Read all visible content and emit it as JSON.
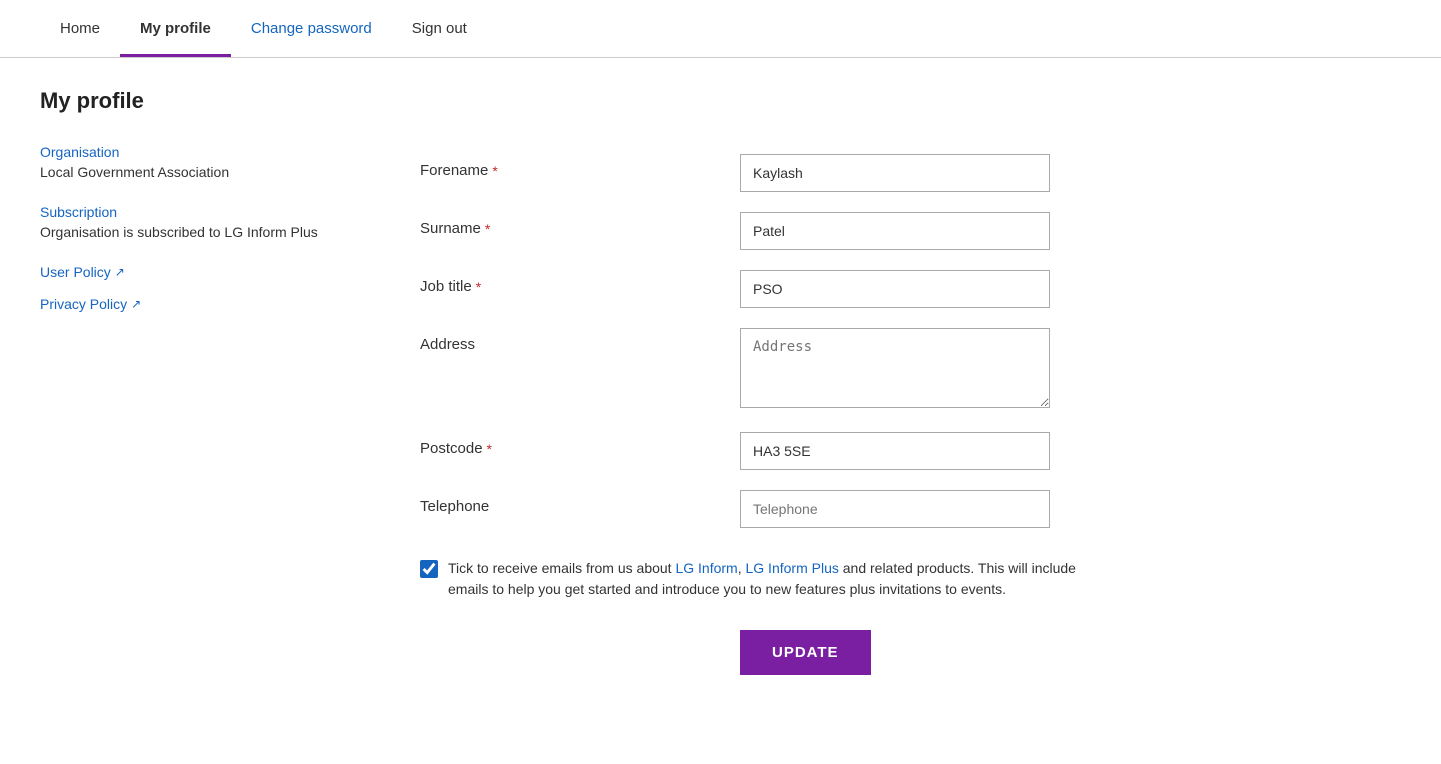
{
  "nav": {
    "items": [
      {
        "id": "home",
        "label": "Home",
        "active": false,
        "link": true
      },
      {
        "id": "my-profile",
        "label": "My profile",
        "active": true,
        "link": false
      },
      {
        "id": "change-password",
        "label": "Change password",
        "active": false,
        "link": true
      },
      {
        "id": "sign-out",
        "label": "Sign out",
        "active": false,
        "link": false
      }
    ]
  },
  "page": {
    "title": "My profile"
  },
  "left": {
    "organisation_label": "Organisation",
    "organisation_value": "Local Government Association",
    "subscription_label": "Subscription",
    "subscription_value": "Organisation is subscribed to LG Inform Plus",
    "user_policy_label": "User Policy",
    "privacy_policy_label": "Privacy Policy"
  },
  "form": {
    "forename_label": "Forename",
    "forename_value": "Kaylash",
    "surname_label": "Surname",
    "surname_value": "Patel",
    "job_title_label": "Job title",
    "job_title_value": "PSO",
    "address_label": "Address",
    "address_placeholder": "Address",
    "postcode_label": "Postcode",
    "postcode_value": "HA3 5SE",
    "telephone_label": "Telephone",
    "telephone_placeholder": "Telephone",
    "checkbox_text": "Tick to receive emails from us about LG Inform, LG Inform Plus and related products. This will include emails to help you get started and introduce you to new features plus invitations to events.",
    "update_button": "UPDATE"
  },
  "icons": {
    "external_link": "↗"
  }
}
